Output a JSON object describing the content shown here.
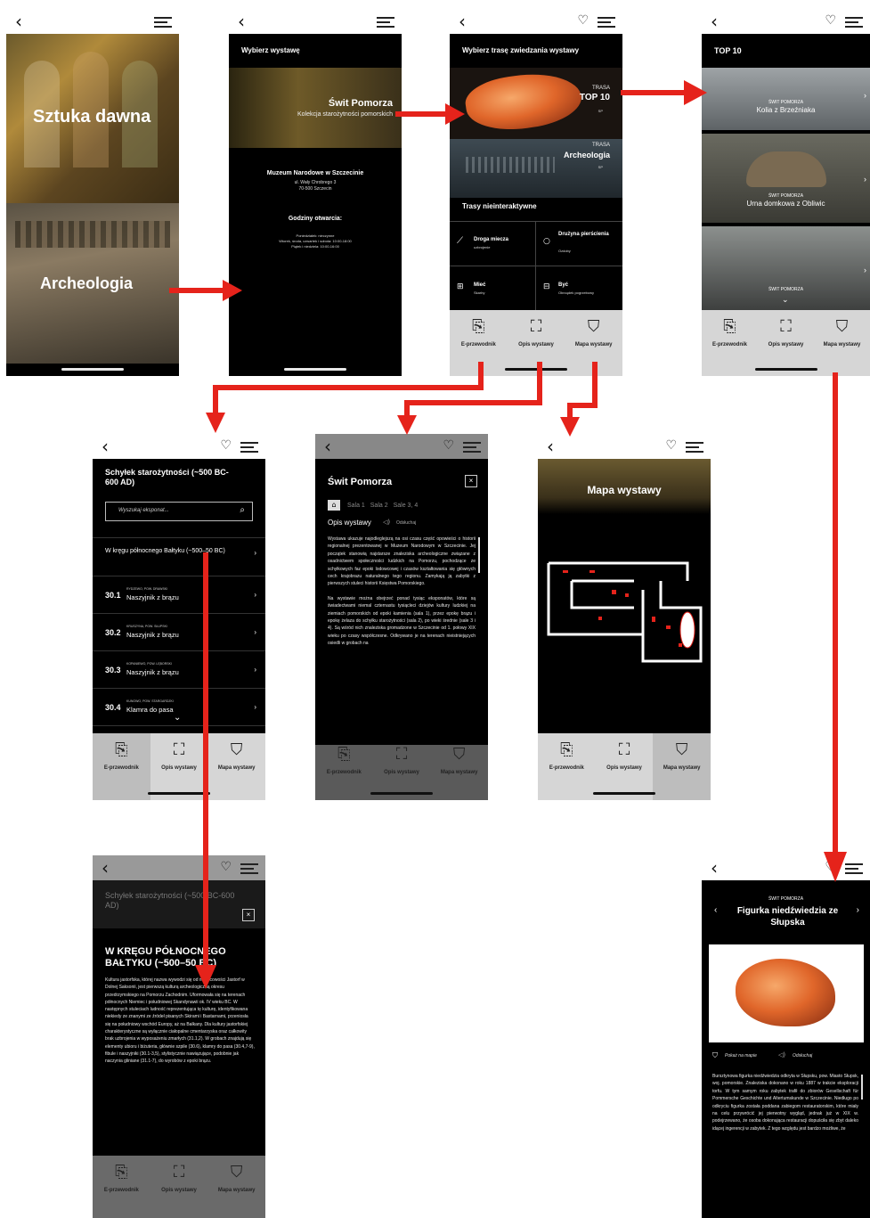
{
  "s1": {
    "title1": "Sztuka dawna",
    "title2": "Archeologia"
  },
  "s2": {
    "heading": "Wybierz wystawę",
    "banner_title": "Świt Pomorza",
    "banner_sub": "Kolekcja starożytności pomorskich",
    "museum": "Muzeum Narodowe w Szczecinie",
    "addr1": "ul. Wały Chrobrego 3",
    "addr2": "70-500 Szczecin",
    "hours_title": "Godziny otwarcia:",
    "hours1": "Poniedziałek: nieczynne",
    "hours2": "Wtorek, środa, czwartek i sobota: 10:00-18:00",
    "hours3": "Piątek i niedziela: 10:00-16:00"
  },
  "s3": {
    "heading": "Wybierz trasę zwiedzania wystawy",
    "r1_small": "TRASA",
    "r1_big": "TOP 10",
    "r1_tag": "SP",
    "r2_small": "TRASA",
    "r2_big": "Archeologia",
    "r2_tag": "SP",
    "noninteractive": "Trasy nieinteraktywne",
    "g1_title": "Droga miecza",
    "g1_sub": "uzbrojenie",
    "g2_title": "Drużyna pierścienia",
    "g2_sub": "Ozdoby",
    "g3_title": "Mieć",
    "g3_sub": "Skarby",
    "g4_title": "Być",
    "g4_sub": "Obrządek pogrzebowy"
  },
  "s4": {
    "heading": "TOP 10",
    "i1_small": "ŚWIT POMORZA",
    "i1_big": "Kolia z Brzeźniaka",
    "i2_small": "ŚWIT POMORZA",
    "i2_big": "Urna domkowa z Obliwic",
    "i3_small": "ŚWIT POMORZA"
  },
  "tabs": {
    "t1": "E-przewodnik",
    "t2": "Opis wystawy",
    "t3": "Mapa wystawy"
  },
  "s5": {
    "heading": "Schyłek starożytności (~500 BC-600 AD)",
    "search_placeholder": "Wyszukaj eksponat...",
    "section": "W kręgu północnego Bałtyku (~500–50 BC)",
    "items": [
      {
        "num": "30.1",
        "loc": "RYDZEWO, POW. DRAWSKI",
        "name": "Naszyjnik z brązu"
      },
      {
        "num": "30.2",
        "loc": "KRUSZYNA, POW. SŁUPSKI",
        "name": "Naszyjnik z brązu"
      },
      {
        "num": "30.3",
        "loc": "KOPANIEWO, POW. LĘBORSKI",
        "name": "Naszyjnik z brązu"
      },
      {
        "num": "30.4",
        "loc": "KUNOWO, POW. STARGARDZKI",
        "name": "Klamra do pasa"
      }
    ]
  },
  "s6": {
    "heading": "Świt Pomorza",
    "tab1": "Sala 1",
    "tab2": "Sala 2",
    "tab3": "Sale 3, 4",
    "sub": "Opis wystawy",
    "listen": "Odsłuchaj",
    "p1": "Wystawa ukazuje najodleglejszą na osi czasu część opowieści o historii regionalnej prezentowanej w Muzeum Narodowym w Szczecinie. Jej początek stanowią najstarsze znaleziska archeologiczne związane z osadnictwem społeczności ludzkich na Pomorzu, pochodzące ze schyłkowych faz epoki lodowcowej i czasów kształtowania się głównych cech krajobrazu naturalnego tego regionu. Zamykają ją zabytki z pierwszych stuleci historii Księstwa Pomorskiego.",
    "p2": "Na wystawie można obejrzeć ponad tysiąc eksponatów, które są świadectwami niemal czternastu tysiącleci dziejów kultury ludzkiej na ziemiach pomorskich od epoki kamienia (sala 1), przez epokę brązu i epokę żelaza do schyłku starożytności (sala 2), po wieki średnie (sale 3 i 4). Są wśród nich znaleziska gromadzone w Szczecinie od 1. połowy XIX wieku po czasy współczesne. Odkrywano je na terenach nieistniejących osiedli w grobach na"
  },
  "s7": {
    "heading": "Mapa wystawy"
  },
  "s8": {
    "heading_faded": "Schyłek starożytności (~500 BC-600 AD)",
    "title": "W KRĘGU PÓŁNOCNEGO BAŁTYKU (~500–50 BC)",
    "body": "Kultura jastorfska, której nazwa wywodzi się od miejscowości Jastorf w Dolnej Saksonii, jest pierwszą kulturą archeologiczną okresu przedrzymskiego na Pomorzu Zachodnim. Uformowała się na terenach północnych Niemiec i południowej Skandynawii ok. IV wieku BC. W następnych stuleciach ludność reprezentująca tę kulturę, identyfikowana niekiedy ze znanymi ze źródeł pisanych Skirami i Bastarnami, przeniosła się na południowy wschód Europy, aż na Bałkany. Dla kultury jastorfskiej charakterystyczne są wyłącznie ciałopalne cmentarzyska oraz całkowity brak uzbrojenia w wyposażeniu zmarłych (31.1,2). W grobach znajdują się elementy ubioru i biżuteria, głównie szpile (30.6), klamry do pasa (30.4,7-9), fibule i naszyjniki (30.1-3,5), stylistycznie nawiązujące, podobnie jak naczynia gliniane (31.1-7), do wyrobów z epoki brązu."
  },
  "s9": {
    "small": "ŚWIT POMORZA",
    "title": "Figurka niedźwiedzia ze Słupska",
    "map": "Pokaż na mapie",
    "listen": "Odsłuchaj",
    "body": "Bursztynowa figurka niedźwiedzia odkryta w Słupsku, pow. Miasto Słupsk, woj. pomorskie. Znaleziska dokonano w roku 1887 w trakcie eksploracji torfu. W tym samym roku zabytek trafił do zbiorów Gesellschaft für Pommersche Geschichte und Altertumskunde w Szczecinie. Niedługo po odkryciu figurka została poddana zabiegom restauratorskim, które miały na celu przywrócić jej pierwotny wygląd, jednak już w XIX w. podejrzewano, że osoba dokonująca restauracji dopuściła się zbyt daleko idącej ingerencji w zabytek. Z tego względu jest bardzo możliwe, że"
  }
}
